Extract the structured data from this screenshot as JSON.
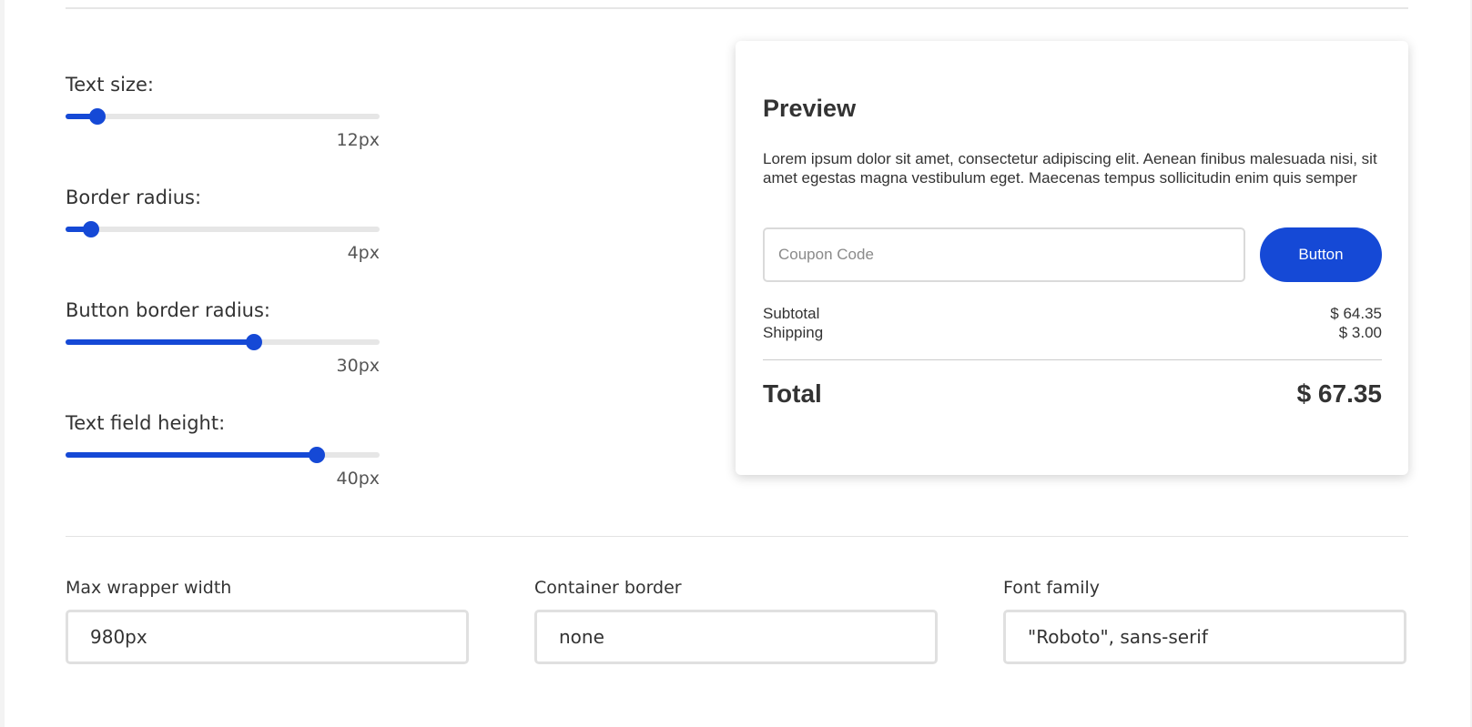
{
  "sliders": [
    {
      "label": "Text size:",
      "value_text": "12px",
      "fraction": 0.1
    },
    {
      "label": "Border radius:",
      "value_text": "4px",
      "fraction": 0.08
    },
    {
      "label": "Button border radius:",
      "value_text": "30px",
      "fraction": 0.6
    },
    {
      "label": "Text field height:",
      "value_text": "40px",
      "fraction": 0.8
    }
  ],
  "preview": {
    "title": "Preview",
    "body": "Lorem ipsum dolor sit amet, consectetur adipiscing elit. Aenean finibus malesuada nisi, sit amet egestas magna vestibulum eget. Maecenas tempus sollicitudin enim quis semper",
    "coupon_placeholder": "Coupon Code",
    "button_label": "Button",
    "subtotal_label": "Subtotal",
    "subtotal_value": "$ 64.35",
    "shipping_label": "Shipping",
    "shipping_value": "$ 3.00",
    "total_label": "Total",
    "total_value": "$ 67.35"
  },
  "fields": {
    "max_wrapper_width": {
      "label": "Max wrapper width",
      "value": "980px"
    },
    "container_border": {
      "label": "Container border",
      "value": "none"
    },
    "font_family": {
      "label": "Font family",
      "value": "\"Roboto\", sans-serif"
    }
  },
  "colors": {
    "accent": "#1549d6",
    "track": "#e6e6e6",
    "text": "#333333"
  }
}
